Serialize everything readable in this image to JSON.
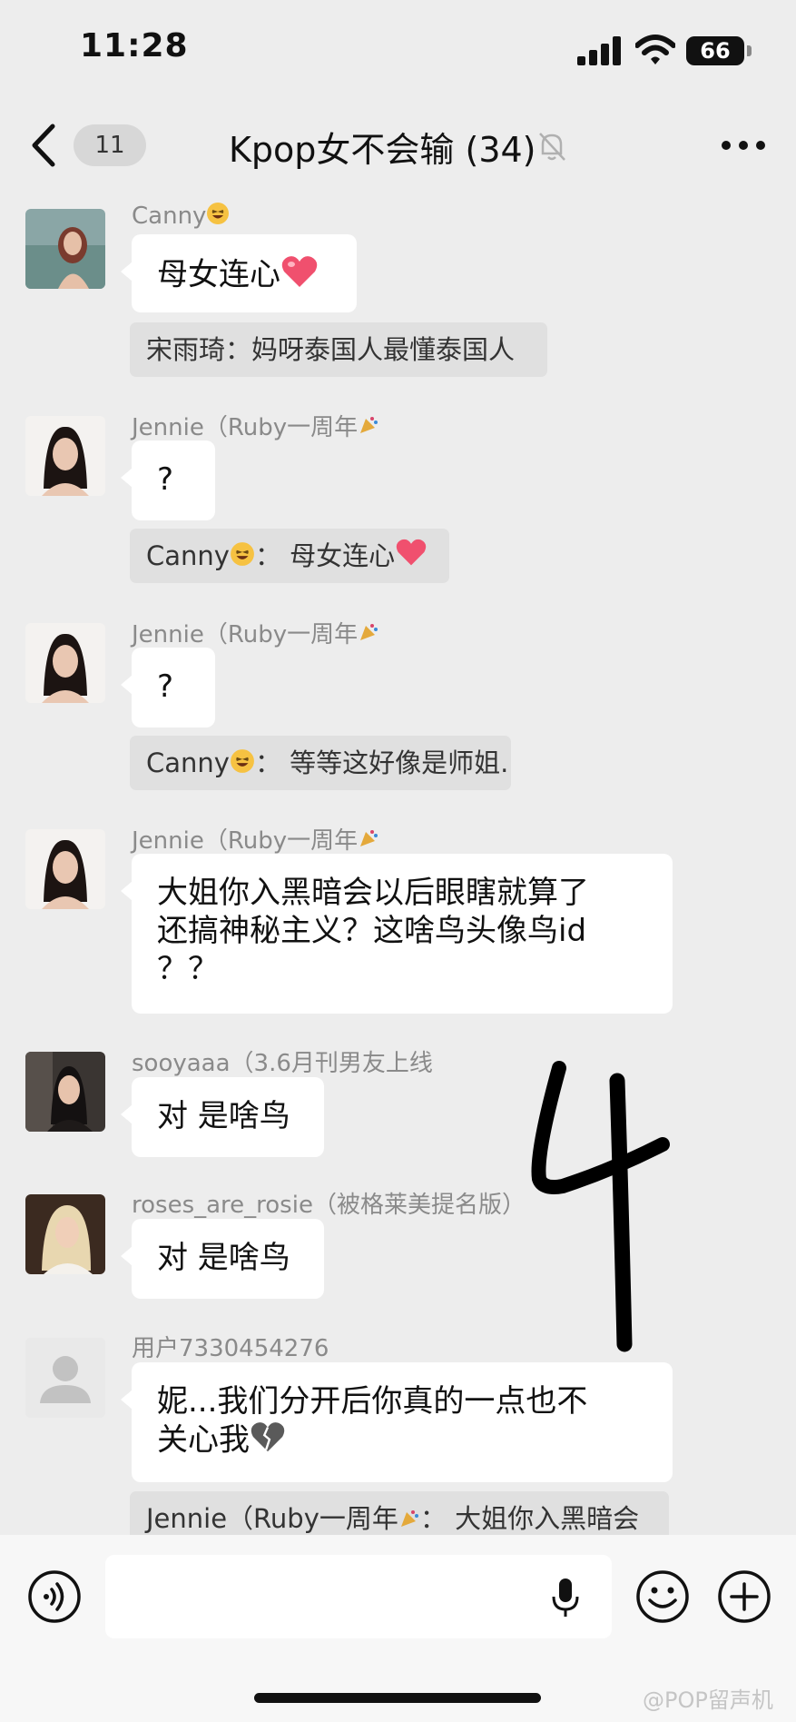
{
  "status": {
    "time": "11:28",
    "battery": "66"
  },
  "header": {
    "unread": "11",
    "title": "Kpop女不会输 (34)"
  },
  "messages": [
    {
      "sender": "Canny",
      "text": "母女连心",
      "quote": "宋雨琦：妈呀泰国人最懂泰国人"
    },
    {
      "sender": "Jennie（Ruby一周年",
      "text": "?",
      "quote_name": "Canny",
      "quote_text": "：  母女连心"
    },
    {
      "sender": "Jennie（Ruby一周年",
      "text": "?",
      "quote_name": "Canny",
      "quote_text": "：  等等这好像是师姐..."
    },
    {
      "sender": "Jennie（Ruby一周年",
      "lines": [
        "大姐你入黑暗会以后眼瞎就算了",
        "还搞神秘主义？这啥鸟头像鸟id",
        "？？"
      ]
    },
    {
      "sender": "sooyaaa（3.6月刊男友上线",
      "text": "对 是啥鸟"
    },
    {
      "sender": "roses_are_rosie（被格莱美提名版）",
      "text": "对 是啥鸟"
    },
    {
      "sender": "用户7330454276",
      "lines": [
        "妮...我们分开后你真的一点也不",
        "关心我"
      ],
      "quote_name": "Jennie（Ruby一周年",
      "quote_text": "：  大姐你入黑暗会"
    }
  ],
  "watermark": "@POP留声机",
  "colors": {
    "background": "#ededed",
    "bubble": "#ffffff",
    "quote": "#e0e0e0",
    "sender": "#8a8a8a"
  }
}
